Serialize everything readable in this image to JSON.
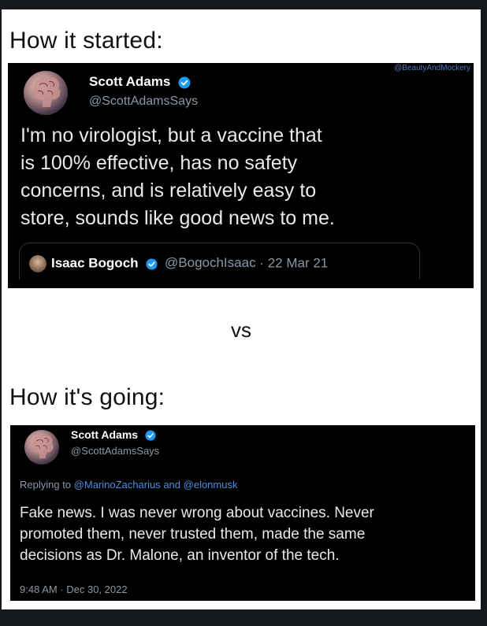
{
  "top_heading": "How it started:",
  "tweet1": {
    "watermark": "@BeautyAndMockery",
    "author_name": "Scott Adams",
    "author_handle": "@ScottAdamsSays",
    "text_lines": [
      "I'm no virologist, but a vaccine that",
      "is 100% effective, has no safety",
      "concerns, and is relatively easy to",
      "store, sounds like good news to me."
    ],
    "quoted": {
      "name": "Isaac Bogoch",
      "handle": "@BogochIsaac",
      "separator": "·",
      "date": "22 Mar 21"
    }
  },
  "separator": "vs",
  "bottom_heading": "How it's going:",
  "tweet2": {
    "author_name": "Scott Adams",
    "author_handle": "@ScottAdamsSays",
    "reply_prefix": "Replying to",
    "reply_mention_1": "@MarinoZacharius",
    "reply_and": "and",
    "reply_mention_2": "@elonmusk",
    "text_lines": [
      "Fake news. I was never wrong about vaccines. Never",
      "promoted them, never trusted them, made the same",
      "decisions as Dr. Malone, an inventor of the tech."
    ],
    "timestamp": "9:48 AM · Dec 30, 2022"
  },
  "colors": {
    "verified": "#1d9bf0",
    "tweet_bg": "#000000",
    "mention": "#4a8fe0"
  },
  "icons": [
    "brain-avatar-icon",
    "verified-badge-icon"
  ]
}
